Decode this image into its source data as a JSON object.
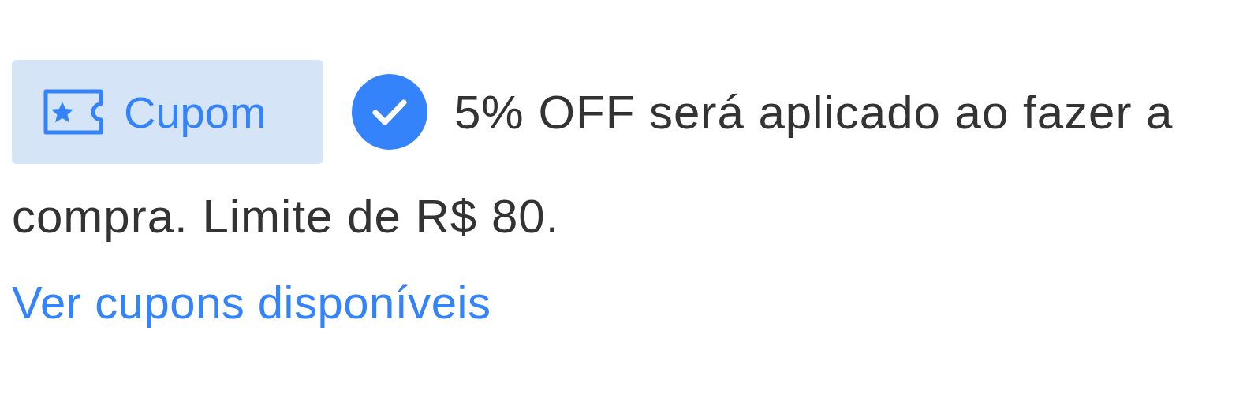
{
  "coupon": {
    "label": "Cupom",
    "applied": true,
    "message_lines": [
      "5% OFF será aplicado ao fazer a",
      "compra. Limite de R$ 80."
    ]
  },
  "link": {
    "label": "Ver cupons disponíveis"
  }
}
